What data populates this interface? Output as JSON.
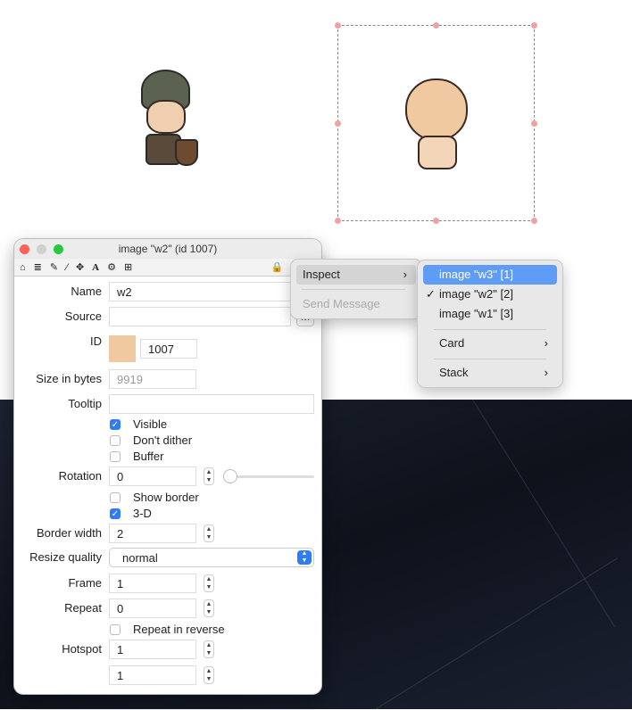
{
  "window": {
    "title": "image \"w2\" (id 1007)"
  },
  "toolbar": {
    "icons": [
      "home-icon",
      "database-icon",
      "pencil-icon",
      "magic-wand-icon",
      "move-icon",
      "text-icon",
      "gears-icon",
      "grid-icon",
      "lock-icon",
      "export-icon",
      "target-icon"
    ]
  },
  "fields": {
    "name_label": "Name",
    "name": "w2",
    "source_label": "Source",
    "source": "",
    "source_btn": "...",
    "id_label": "ID",
    "id": "1007",
    "size_label": "Size in bytes",
    "size": "9919",
    "tooltip_label": "Tooltip",
    "tooltip": "",
    "visible": "Visible",
    "dont_dither": "Don't dither",
    "buffer": "Buffer",
    "rotation_label": "Rotation",
    "rotation": "0",
    "show_border": "Show border",
    "three_d": "3-D",
    "border_width_label": "Border width",
    "border_width": "2",
    "resize_label": "Resize quality",
    "resize": "normal",
    "frame_label": "Frame",
    "frame": "1",
    "repeat_label": "Repeat",
    "repeat": "0",
    "repeat_reverse": "Repeat in reverse",
    "hotspot_label": "Hotspot",
    "hotspot_x": "1",
    "hotspot_y": "1"
  },
  "checks": {
    "visible": true,
    "dont_dither": false,
    "buffer": false,
    "show_border": false,
    "three_d": true,
    "repeat_reverse": false
  },
  "context_menu": {
    "inspect": "Inspect",
    "send_message": "Send Message"
  },
  "submenu": {
    "items": [
      "image \"w3\" [1]",
      "image \"w2\" [2]",
      "image \"w1\" [3]"
    ],
    "checked": 1,
    "highlighted": 0,
    "card": "Card",
    "stack": "Stack"
  },
  "colors": {
    "highlight": "#5e9cf5",
    "check": "#2f7cf6"
  }
}
